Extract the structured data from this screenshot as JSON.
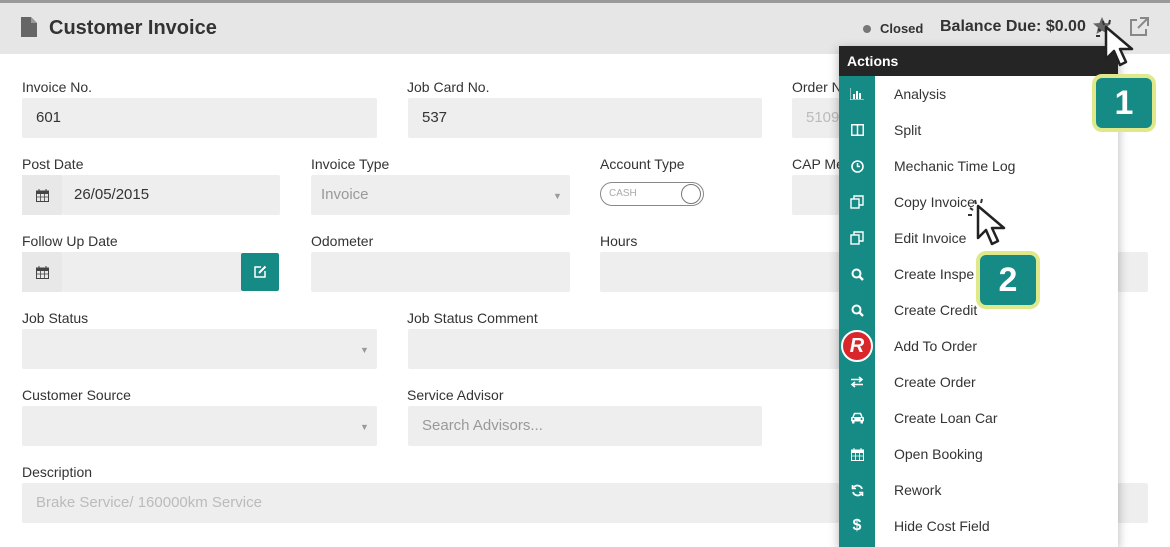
{
  "header": {
    "title": "Customer Invoice",
    "status": "Closed",
    "balance": "Balance Due: $0.00"
  },
  "form": {
    "invoice_no": {
      "label": "Invoice No.",
      "value": "601"
    },
    "job_card_no": {
      "label": "Job Card No.",
      "value": "537"
    },
    "order_no": {
      "label": "Order N",
      "value": "5109"
    },
    "post_date": {
      "label": "Post Date",
      "value": "26/05/2015"
    },
    "invoice_type": {
      "label": "Invoice Type",
      "value": "Invoice"
    },
    "account_type": {
      "label": "Account Type",
      "toggle_text": "CASH"
    },
    "cap_me": {
      "label": "CAP Me"
    },
    "follow_up_date": {
      "label": "Follow Up Date",
      "value": ""
    },
    "odometer": {
      "label": "Odometer",
      "value": ""
    },
    "hours": {
      "label": "Hours",
      "value": ""
    },
    "job_status": {
      "label": "Job Status",
      "value": ""
    },
    "job_status_comment": {
      "label": "Job Status Comment",
      "value": ""
    },
    "customer_source": {
      "label": "Customer Source",
      "value": ""
    },
    "service_advisor": {
      "label": "Service Advisor",
      "placeholder": "Search Advisors..."
    },
    "description": {
      "label": "Description",
      "value": "Brake Service/ 160000km Service"
    }
  },
  "actions_menu": {
    "title": "Actions",
    "items": [
      {
        "label": "Analysis",
        "icon": "bar-chart-icon"
      },
      {
        "label": "Split",
        "icon": "columns-icon"
      },
      {
        "label": "Mechanic Time Log",
        "icon": "clock-icon"
      },
      {
        "label": "Copy Invoice",
        "icon": "copy-icon"
      },
      {
        "label": "Edit Invoice",
        "icon": "copy-icon"
      },
      {
        "label": "Create Inspe",
        "icon": "search-icon"
      },
      {
        "label": "Create Credit",
        "icon": "search-icon"
      },
      {
        "label": "Add To Order",
        "icon": "repco-logo"
      },
      {
        "label": "Create Order",
        "icon": "exchange-icon"
      },
      {
        "label": "Create Loan Car",
        "icon": "car-icon"
      },
      {
        "label": "Open Booking",
        "icon": "calendar-icon"
      },
      {
        "label": "Rework",
        "icon": "refresh-icon"
      },
      {
        "label": "Hide Cost Field",
        "icon": "dollar-icon"
      }
    ]
  },
  "annotations": {
    "step1": "1",
    "step2": "2"
  },
  "colors": {
    "accent": "#168a84",
    "badge_border": "#dfe98a",
    "menu_header": "#252525"
  }
}
